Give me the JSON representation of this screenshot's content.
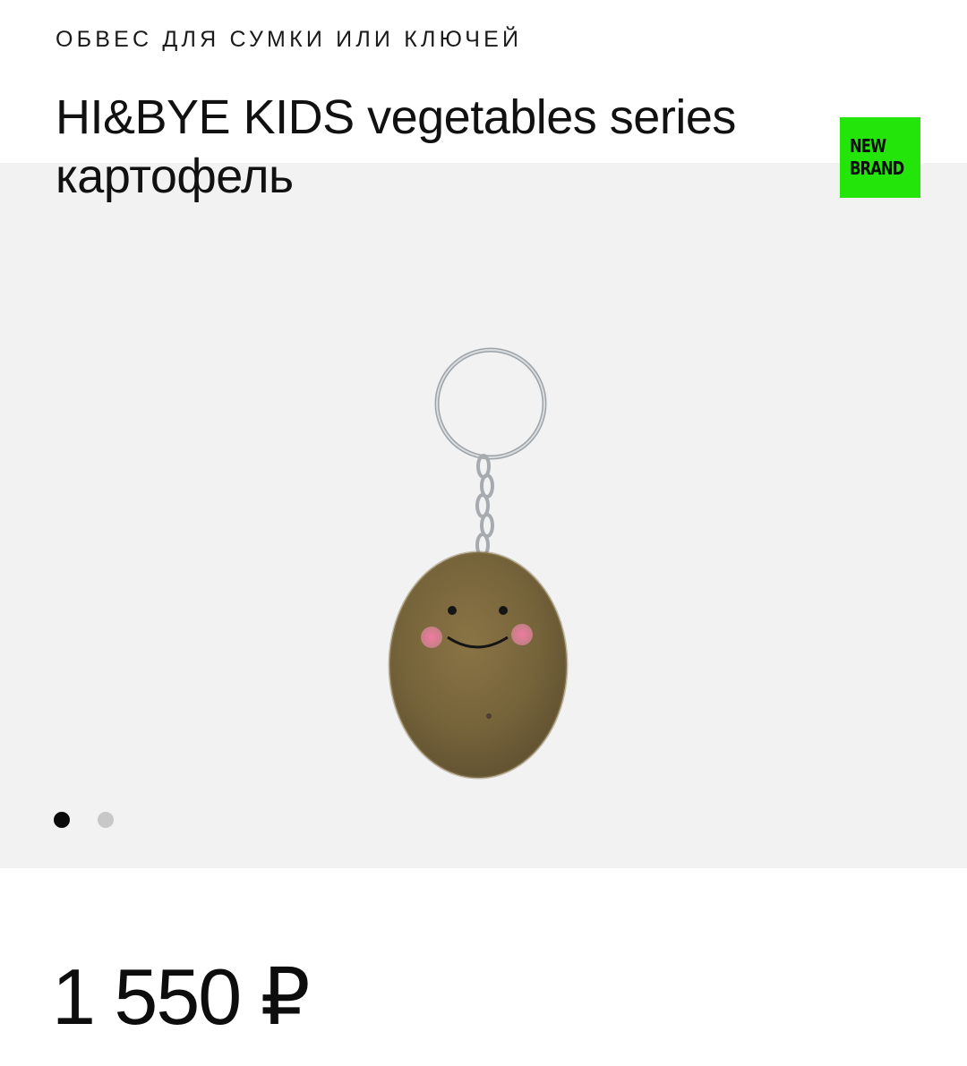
{
  "product": {
    "category": "ОБВЕС ДЛЯ СУМКИ ИЛИ КЛЮЧЕЙ",
    "title": "HI&BYE KIDS vegetables series картофель",
    "badge": {
      "line1": "NEW",
      "line2": "BRAND",
      "color": "#23e50a"
    },
    "price": "1 550 ₽"
  },
  "gallery": {
    "background": "#f2f2f2",
    "image_icon": "potato-keychain-photo",
    "slides_count": 2,
    "active_slide": 1
  }
}
